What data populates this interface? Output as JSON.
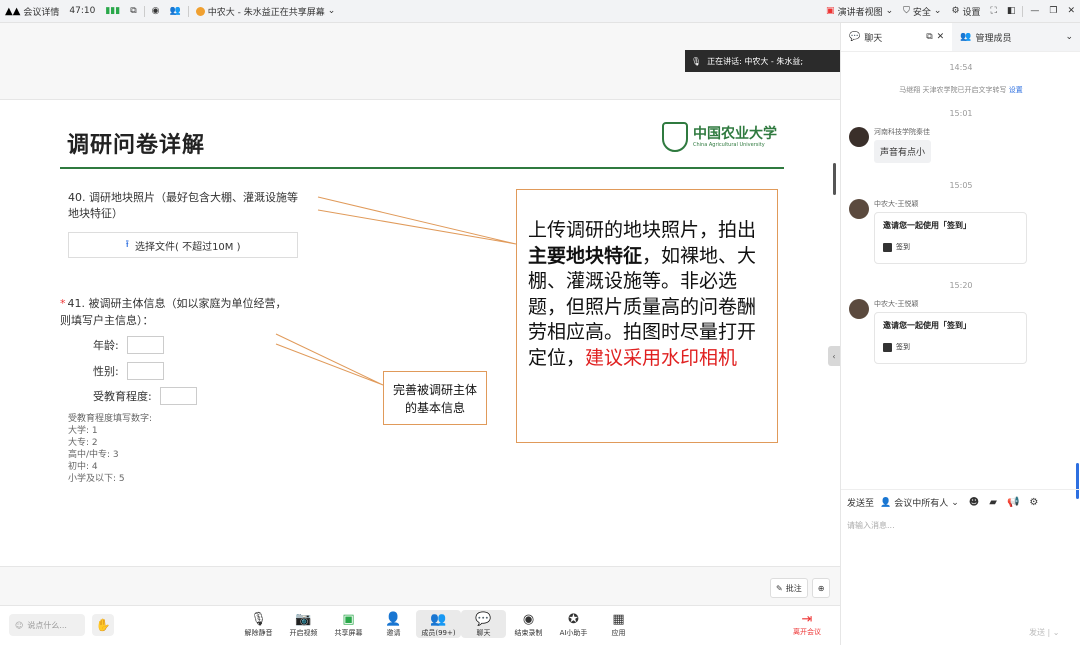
{
  "topbar": {
    "meeting_details": "会议详情",
    "duration": "47:10",
    "sharer_text": "中农大 - 朱水益正在共享屏幕",
    "speaker_view": "演讲者视图",
    "security": "安全",
    "settings": "设置"
  },
  "speaker_banner": "正在讲话: 中农大 - 朱水益;",
  "slide": {
    "title": "调研问卷详解",
    "logo_cn": "中国农业大学",
    "logo_en": "China Agricultural University",
    "q40": "40. 调研地块照片（最好包含大棚、灌溉设施等地块特征）",
    "upload_label": "选择文件( 不超过10M )",
    "q41": "41.  被调研主体信息（如以家庭为单位经营，则填写户主信息）：",
    "field_age": "年龄:",
    "field_gender": "性别:",
    "field_edu": "受教育程度:",
    "edu_legend": [
      "受教育程度填写数字:",
      "大学: 1",
      "大专: 2",
      "高中/中专: 3",
      "初中: 4",
      "小学及以下: 5"
    ],
    "callout_big_1": "上传调研的地块照片，拍出",
    "callout_big_bold": "主要地块特征",
    "callout_big_2": "，如裸地、大棚、灌溉设施等。非必选题，但照片质量高的问卷酬劳相应高。拍图时尽量打开定位，",
    "callout_big_red": "建议采用水印相机",
    "callout_small": "完善被调研主体的基本信息"
  },
  "annot": {
    "annotate": "批注",
    "zoom": "⊕"
  },
  "bottombar": {
    "say_placeholder": "说点什么...",
    "controls": [
      {
        "label": "解除静音",
        "icon": "mic-muted-icon"
      },
      {
        "label": "开启视频",
        "icon": "camera-off-icon"
      },
      {
        "label": "共享屏幕",
        "icon": "share-screen-icon"
      },
      {
        "label": "邀请",
        "icon": "invite-icon"
      },
      {
        "label": "成员(99+)",
        "icon": "members-icon"
      },
      {
        "label": "聊天",
        "icon": "chat-icon"
      },
      {
        "label": "结束录制",
        "icon": "record-icon"
      },
      {
        "label": "AI小助手",
        "icon": "ai-assistant-icon"
      },
      {
        "label": "应用",
        "icon": "apps-icon"
      }
    ],
    "leave": "离开会议"
  },
  "panel": {
    "tab_chat": "聊天",
    "tab_members": "管理成员",
    "time1": "14:54",
    "sys_msg": "马继翔 天津农学院已开启文字转写",
    "sys_link": "设置",
    "time2": "15:01",
    "msg1_name": "河南科技学院秦佳",
    "msg1_text": "声音有点小",
    "time3": "15:05",
    "msg2_name": "中农大-王悦颖",
    "card_title": "邀请您一起使用「签到」",
    "card_item": "签到",
    "time4": "15:20",
    "msg3_name": "中农大-王悦颖",
    "send_to": "发送至",
    "send_target": "会议中所有人",
    "input_placeholder": "请输入消息...",
    "send_button": "发送"
  }
}
